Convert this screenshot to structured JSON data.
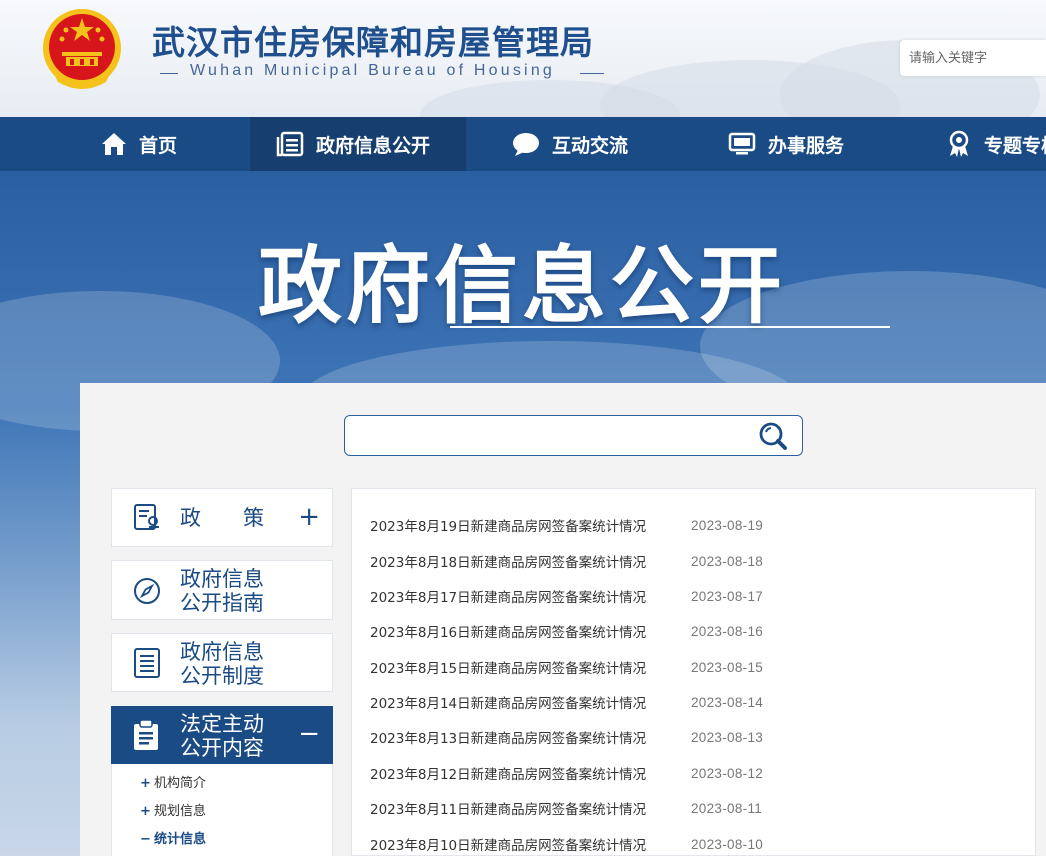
{
  "header": {
    "title": "武汉市住房保障和房屋管理局",
    "subtitle": "Wuhan Municipal Bureau of Housing",
    "search_placeholder": "请输入关键字"
  },
  "nav": {
    "items": [
      {
        "label": "首页",
        "icon": "home-icon"
      },
      {
        "label": "政府信息公开",
        "icon": "document-list-icon",
        "active": true
      },
      {
        "label": "互动交流",
        "icon": "chat-bubble-icon"
      },
      {
        "label": "办事服务",
        "icon": "monitor-icon"
      },
      {
        "label": "专题专栏",
        "icon": "award-icon"
      }
    ]
  },
  "banner": {
    "title": "政府信息公开"
  },
  "main_search": {
    "placeholder": ""
  },
  "sidebar": {
    "items": [
      {
        "label": "政　　策",
        "icon": "policy-doc-icon",
        "toggle": "+"
      },
      {
        "label": "政府信息\n公开指南",
        "icon": "compass-icon"
      },
      {
        "label": "政府信息\n公开制度",
        "icon": "list-doc-icon"
      },
      {
        "label": "法定主动\n公开内容",
        "icon": "clipboard-icon",
        "toggle": "−",
        "active": true
      }
    ],
    "sub_items": [
      {
        "marker": "+",
        "label": "机构简介"
      },
      {
        "marker": "+",
        "label": "规划信息"
      },
      {
        "marker": "−",
        "label": "统计信息",
        "active": true
      }
    ]
  },
  "list": {
    "rows": [
      {
        "title": "2023年8月19日新建商品房网签备案统计情况",
        "date": "2023-08-19"
      },
      {
        "title": "2023年8月18日新建商品房网签备案统计情况",
        "date": "2023-08-18"
      },
      {
        "title": "2023年8月17日新建商品房网签备案统计情况",
        "date": "2023-08-17"
      },
      {
        "title": "2023年8月16日新建商品房网签备案统计情况",
        "date": "2023-08-16"
      },
      {
        "title": "2023年8月15日新建商品房网签备案统计情况",
        "date": "2023-08-15"
      },
      {
        "title": "2023年8月14日新建商品房网签备案统计情况",
        "date": "2023-08-14"
      },
      {
        "title": "2023年8月13日新建商品房网签备案统计情况",
        "date": "2023-08-13"
      },
      {
        "title": "2023年8月12日新建商品房网签备案统计情况",
        "date": "2023-08-12"
      },
      {
        "title": "2023年8月11日新建商品房网签备案统计情况",
        "date": "2023-08-11"
      },
      {
        "title": "2023年8月10日新建商品房网签备案统计情况",
        "date": "2023-08-10"
      }
    ]
  },
  "colors": {
    "primary": "#1b4b85",
    "banner": "#2a5fa2",
    "emblem_red": "#d7161b",
    "emblem_gold": "#f5c21b"
  }
}
